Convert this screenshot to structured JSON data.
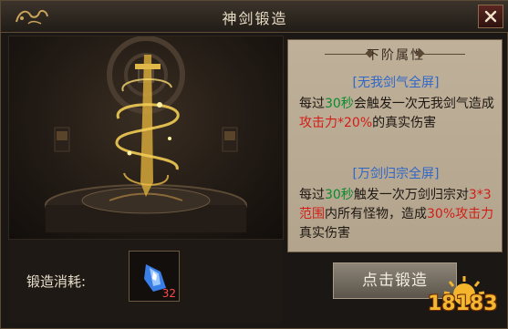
{
  "window": {
    "title": "神剑锻造",
    "close_icon": "close-icon"
  },
  "attributes": {
    "header": "下阶属性",
    "skills": [
      {
        "name": "[无我剑气全屏]",
        "desc": [
          {
            "text": "每过",
            "color": "normal"
          },
          {
            "text": "30秒",
            "color": "green"
          },
          {
            "text": "会触发一次无我剑气造成",
            "color": "normal"
          },
          {
            "text": "攻击力*20%",
            "color": "red"
          },
          {
            "text": "的真实伤害",
            "color": "normal"
          }
        ]
      },
      {
        "name": "[万剑归宗全屏]",
        "desc": [
          {
            "text": "每过",
            "color": "normal"
          },
          {
            "text": "30秒",
            "color": "green"
          },
          {
            "text": "触发一次万剑归宗对",
            "color": "normal"
          },
          {
            "text": "3*3范围",
            "color": "red"
          },
          {
            "text": "内所有怪物，造成",
            "color": "normal"
          },
          {
            "text": "30%攻击力",
            "color": "red"
          },
          {
            "text": "真实伤害",
            "color": "normal"
          }
        ]
      }
    ]
  },
  "cost": {
    "label": "锻造消耗:",
    "item_icon": "crystal-shard-icon",
    "item_count": "32"
  },
  "forge_button": {
    "label": "点击锻造"
  },
  "watermark": {
    "text": "18183"
  },
  "colors": {
    "green": "#0b8a2e",
    "red": "#d21e16",
    "skill_name": "#2f67c9"
  }
}
